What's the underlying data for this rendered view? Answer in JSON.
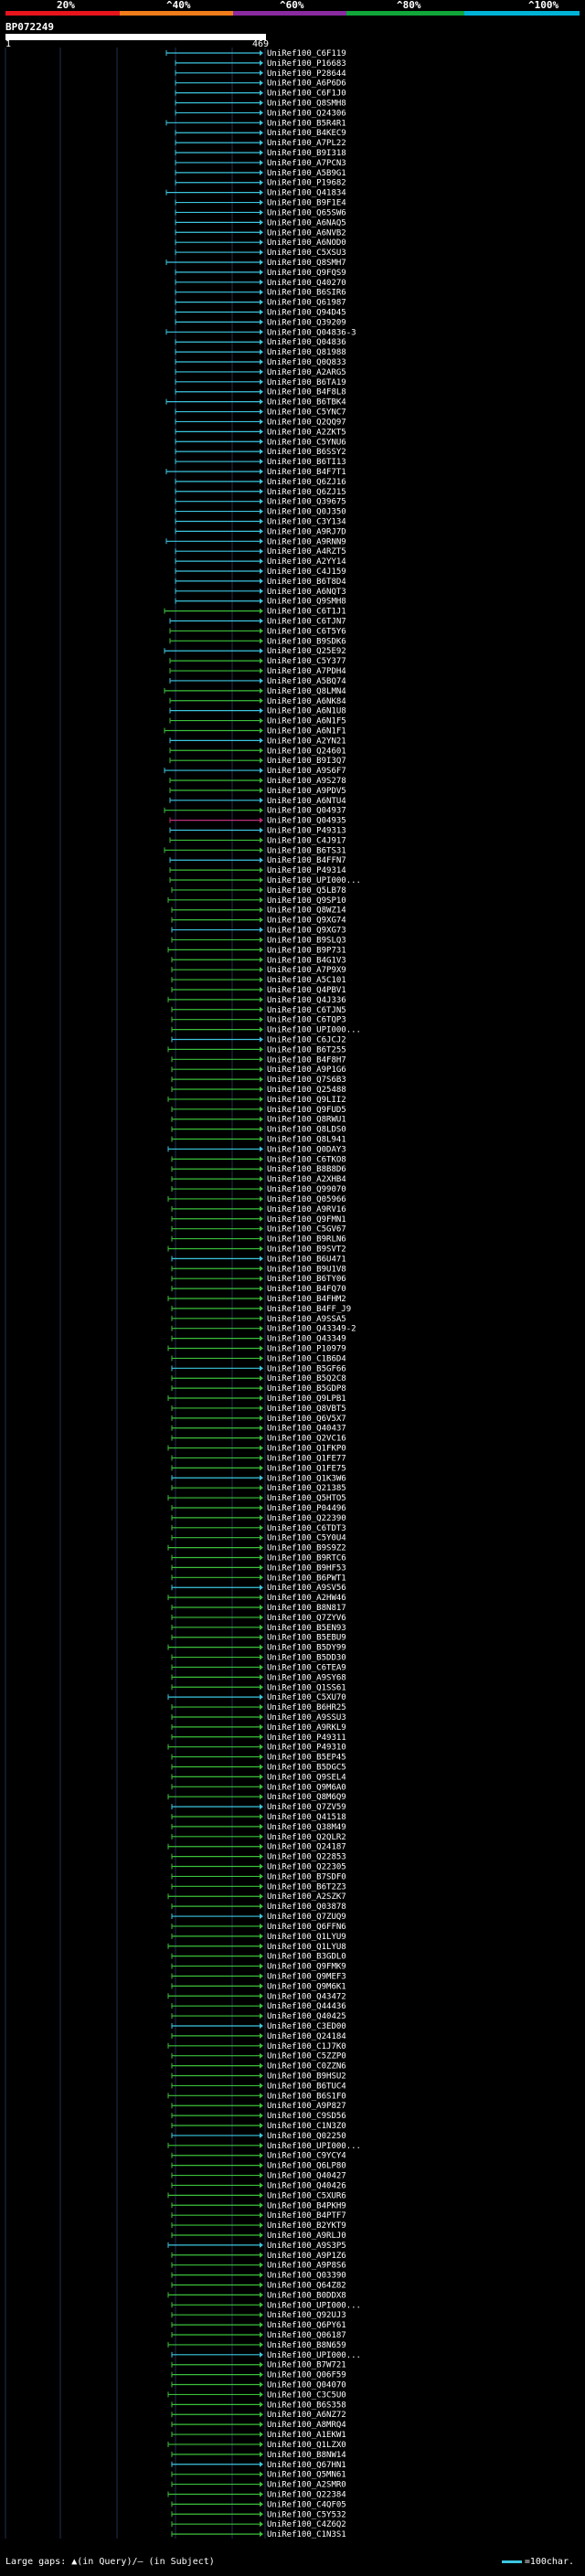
{
  "colors": {
    "segment_1": "#e8141c",
    "segment_2": "#f07d1a",
    "segment_3": "#8a2aa0",
    "segment_4": "#11a63a",
    "segment_5": "#00b3d6",
    "hit_cyan": "#3cc6e0",
    "hit_green": "#3bbf3b",
    "hit_magenta": "#c0307a",
    "background": "#000000",
    "grid": "#203050"
  },
  "scale": {
    "labels": [
      "20%",
      "^40%",
      "^60%",
      "^80%",
      "^100%"
    ]
  },
  "query": {
    "id": "BP072249",
    "start": "1",
    "end": "469"
  },
  "hits": [
    "UniRef100_C6F119",
    "UniRef100_P16683",
    "UniRef100_P28644",
    "UniRef100_A6P6D6",
    "UniRef100_C6F1J0",
    "UniRef100_Q8SMH8",
    "UniRef100_Q24306",
    "UniRef100_B5R4R1",
    "UniRef100_B4KEC9",
    "UniRef100_A7PL22",
    "UniRef100_B9I318",
    "UniRef100_A7PCN3",
    "UniRef100_A5B9G1",
    "UniRef100_P19682",
    "UniRef100_Q41834",
    "UniRef100_B9F1E4",
    "UniRef100_Q65SW6",
    "UniRef100_A6NAQ5",
    "UniRef100_A6NVB2",
    "UniRef100_A6NOD0",
    "UniRef100_C5XSU3",
    "UniRef100_Q8SMH7",
    "UniRef100_Q9FQS9",
    "UniRef100_Q40270",
    "UniRef100_B6SIR6",
    "UniRef100_Q61987",
    "UniRef100_Q94D45",
    "UniRef100_Q39209",
    "UniRef100_Q04836-3",
    "UniRef100_Q04836",
    "UniRef100_Q81988",
    "UniRef100_Q0Q833",
    "UniRef100_A2ARG5",
    "UniRef100_B6TA19",
    "UniRef100_B4F8L8",
    "UniRef100_B6TBK4",
    "UniRef100_C5YNC7",
    "UniRef100_Q2QQ97",
    "UniRef100_A2ZKT5",
    "UniRef100_C5YNU6",
    "UniRef100_B6SSY2",
    "UniRef100_B6TI13",
    "UniRef100_B4F7T1",
    "UniRef100_Q6ZJ16",
    "UniRef100_Q6ZJ15",
    "UniRef100_Q39675",
    "UniRef100_Q0J350",
    "UniRef100_C3Y134",
    "UniRef100_A9RJ7D",
    "UniRef100_A9RNN9",
    "UniRef100_A4RZT5",
    "UniRef100_A2YY14",
    "UniRef100_C4J159",
    "UniRef100_B6T8D4",
    "UniRef100_A6NQT3",
    "UniRef100_Q9SMH8",
    "UniRef100_C6T1J1",
    "UniRef100_C6TJN7",
    "UniRef100_C6T5Y6",
    "UniRef100_B9SDK6",
    "UniRef100_Q25E92",
    "UniRef100_C5Y377",
    "UniRef100_A7PDH4",
    "UniRef100_A5BQ74",
    "UniRef100_Q8LMN4",
    "UniRef100_A6NK84",
    "UniRef100_A6N1U8",
    "UniRef100_A6N1F5",
    "UniRef100_A6N1F1",
    "UniRef100_A2YN21",
    "UniRef100_Q24601",
    "UniRef100_B9I3Q7",
    "UniRef100_A9S6F7",
    "UniRef100_A9S278",
    "UniRef100_A9PDV5",
    "UniRef100_A6NTU4",
    "UniRef100_Q04937",
    "UniRef100_Q04935",
    "UniRef100_P49313",
    "UniRef100_C4J917",
    "UniRef100_B6TS31",
    "UniRef100_B4FFN7",
    "UniRef100_P49314",
    "UniRef100_UPI000...",
    "UniRef100_Q5LB78",
    "UniRef100_Q9SP10",
    "UniRef100_Q8WZ14",
    "UniRef100_Q9XG74",
    "UniRef100_Q9XG73",
    "UniRef100_B9SLQ3",
    "UniRef100_B9P731",
    "UniRef100_B4G1V3",
    "UniRef100_A7P9X9",
    "UniRef100_A5C101",
    "UniRef100_Q4PBV1",
    "UniRef100_Q4J336",
    "UniRef100_C6TJN5",
    "UniRef100_C6TQP3",
    "UniRef100_UPI000...",
    "UniRef100_C6JCJ2",
    "UniRef100_B6T255",
    "UniRef100_B4F8H7",
    "UniRef100_A9P1G6",
    "UniRef100_Q7S6B3",
    "UniRef100_Q25488",
    "UniRef100_Q9LII2",
    "UniRef100_Q9FUD5",
    "UniRef100_Q8RWU1",
    "UniRef100_Q8LDS0",
    "UniRef100_Q8L941",
    "UniRef100_Q0DAY3",
    "UniRef100_C6TKO8",
    "UniRef100_B8B8D6",
    "UniRef100_A2XHB4",
    "UniRef100_Q99070",
    "UniRef100_Q05966",
    "UniRef100_A9RV16",
    "UniRef100_Q9FMN1",
    "UniRef100_C5GV67",
    "UniRef100_B9RLN6",
    "UniRef100_B9SVT2",
    "UniRef100_B6U471",
    "UniRef100_B9U1V8",
    "UniRef100_B6TY06",
    "UniRef100_B4FQ70",
    "UniRef100_B4FHM2",
    "UniRef100_B4FF_J9",
    "UniRef100_A9SSA5",
    "UniRef100_Q43349-2",
    "UniRef100_Q43349",
    "UniRef100_P10979",
    "UniRef100_C1B6D4",
    "UniRef100_B5GF66",
    "UniRef100_B5Q2C8",
    "UniRef100_B5GDP8",
    "UniRef100_Q9LPB1",
    "UniRef100_Q8VBT5",
    "UniRef100_Q6V5X7",
    "UniRef100_Q40437",
    "UniRef100_Q2VC16",
    "UniRef100_Q1FKP0",
    "UniRef100_Q1FE77",
    "UniRef100_Q1FE75",
    "UniRef100_Q1K3W6",
    "UniRef100_Q21385",
    "UniRef100_Q5HTO5",
    "UniRef100_P04496",
    "UniRef100_Q22390",
    "UniRef100_C6TDT3",
    "UniRef100_C5Y0U4",
    "UniRef100_B9S9Z2",
    "UniRef100_B9RTC6",
    "UniRef100_B9HF53",
    "UniRef100_B6PWT1",
    "UniRef100_A9SV56",
    "UniRef100_A2HW46",
    "UniRef100_B8N817",
    "UniRef100_Q7ZYV6",
    "UniRef100_B5EN93",
    "UniRef100_B5EBU9",
    "UniRef100_B5DY99",
    "UniRef100_B5DD30",
    "UniRef100_C6TEA9",
    "UniRef100_A9SY68",
    "UniRef100_Q1SS61",
    "UniRef100_C5XU70",
    "UniRef100_B6HR25",
    "UniRef100_A9SSU3",
    "UniRef100_A9RKL9",
    "UniRef100_P49311",
    "UniRef100_P49310",
    "UniRef100_B5EP45",
    "UniRef100_B5DGC5",
    "UniRef100_Q9SEL4",
    "UniRef100_Q9M6A0",
    "UniRef100_Q8M6Q9",
    "UniRef100_Q7ZV59",
    "UniRef100_Q41518",
    "UniRef100_Q38M49",
    "UniRef100_Q2QLR2",
    "UniRef100_Q24187",
    "UniRef100_Q22853",
    "UniRef100_Q22305",
    "UniRef100_B7SDF0",
    "UniRef100_B6T2Z3",
    "UniRef100_A2SZK7",
    "UniRef100_Q03878",
    "UniRef100_Q7ZUQ9",
    "UniRef100_Q6FFN6",
    "UniRef100_Q1LYU9",
    "UniRef100_Q1LYU8",
    "UniRef100_B3GDL0",
    "UniRef100_Q9FMK9",
    "UniRef100_Q9MEF3",
    "UniRef100_Q9M6K1",
    "UniRef100_Q43472",
    "UniRef100_Q44436",
    "UniRef100_Q40425",
    "UniRef100_C3ED00",
    "UniRef100_Q24184",
    "UniRef100_C1J7K0",
    "UniRef100_C5ZZP0",
    "UniRef100_C0ZZN6",
    "UniRef100_B9HSU2",
    "UniRef100_B6TUC4",
    "UniRef100_B6S1F0",
    "UniRef100_A9P827",
    "UniRef100_C9SD56",
    "UniRef100_C1N3Z0",
    "UniRef100_Q02250",
    "UniRef100_UPI000...",
    "UniRef100_C9YCY4",
    "UniRef100_Q6LP80",
    "UniRef100_Q40427",
    "UniRef100_Q40426",
    "UniRef100_C5XUR6",
    "UniRef100_B4PKH9",
    "UniRef100_B4PTF7",
    "UniRef100_B2YKT9",
    "UniRef100_A9RLJ0",
    "UniRef100_A9S3P5",
    "UniRef100_A9P1Z6",
    "UniRef100_A9P8S6",
    "UniRef100_Q03390",
    "UniRef100_Q64Z82",
    "UniRef100_B0DDX8",
    "UniRef100_UPI000...",
    "UniRef100_Q92UJ3",
    "UniRef100_Q6PY61",
    "UniRef100_Q06187",
    "UniRef100_B8N659",
    "UniRef100_UPI000...",
    "UniRef100_B7W721",
    "UniRef100_Q06F59",
    "UniRef100_Q04070",
    "UniRef100_C3C5U0",
    "UniRef100_B6S358",
    "UniRef100_A6NZ72",
    "UniRef100_A8MRQ4",
    "UniRef100_A1EKW1",
    "UniRef100_Q1LZX0",
    "UniRef100_B8NW14",
    "UniRef100_Q67HN1",
    "UniRef100_Q5MN61",
    "UniRef100_A2SMR0",
    "UniRef100_Q22384",
    "UniRef100_C4QF05",
    "UniRef100_C5Y532",
    "UniRef100_C4Z6Q2",
    "UniRef100_C1N3S1"
  ],
  "legend": {
    "gaps_text": "Large gaps: ▲(in Query)/‒ (in Subject)",
    "scale_text": "=100char."
  }
}
